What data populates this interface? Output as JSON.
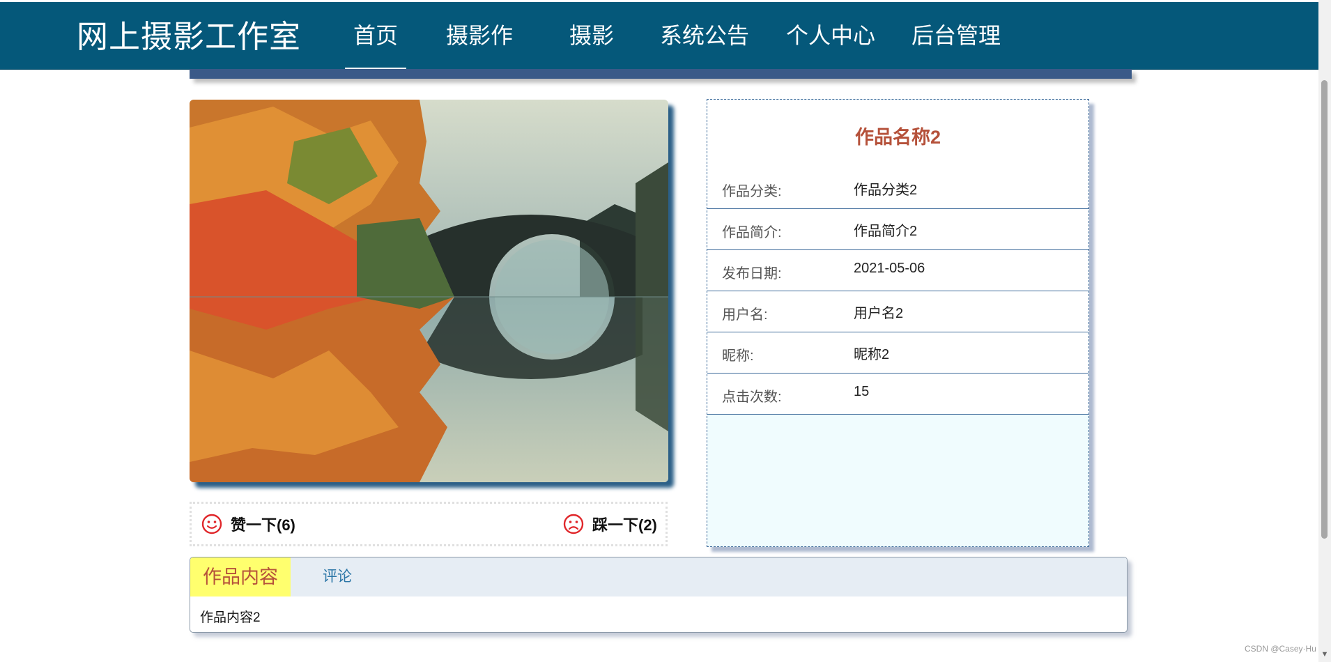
{
  "app": {
    "brand": "网上摄影工作室"
  },
  "nav": {
    "items": [
      {
        "label": "首页",
        "active": true
      },
      {
        "label": "摄影作品"
      },
      {
        "label": "摄影圈"
      },
      {
        "label": "系统公告"
      },
      {
        "label": "个人中心"
      },
      {
        "label": "后台管理"
      }
    ]
  },
  "work": {
    "title": "作品名称2",
    "fields": [
      {
        "label": "作品分类:",
        "value": "作品分类2"
      },
      {
        "label": "作品简介:",
        "value": "作品简介2"
      },
      {
        "label": "发布日期:",
        "value": "2021-05-06"
      },
      {
        "label": "用户名:",
        "value": "用户名2"
      },
      {
        "label": "昵称:",
        "value": "昵称2"
      },
      {
        "label": "点击次数:",
        "value": "15"
      }
    ]
  },
  "votes": {
    "like_label": "赞一下(6)",
    "dislike_label": "踩一下(2)"
  },
  "tabs": {
    "items": [
      {
        "label": "作品内容",
        "active": true
      },
      {
        "label": "评论"
      }
    ],
    "content": "作品内容2"
  },
  "footer": {
    "watermark": "CSDN @Casey·Hu"
  },
  "colors": {
    "navbar": "#05587a",
    "title_accent": "#b5513a",
    "tab_active_bg": "#ffff6e",
    "panel_bg": "#f0fcfe"
  },
  "icons": {
    "like": "smile-icon",
    "dislike": "frown-icon"
  }
}
